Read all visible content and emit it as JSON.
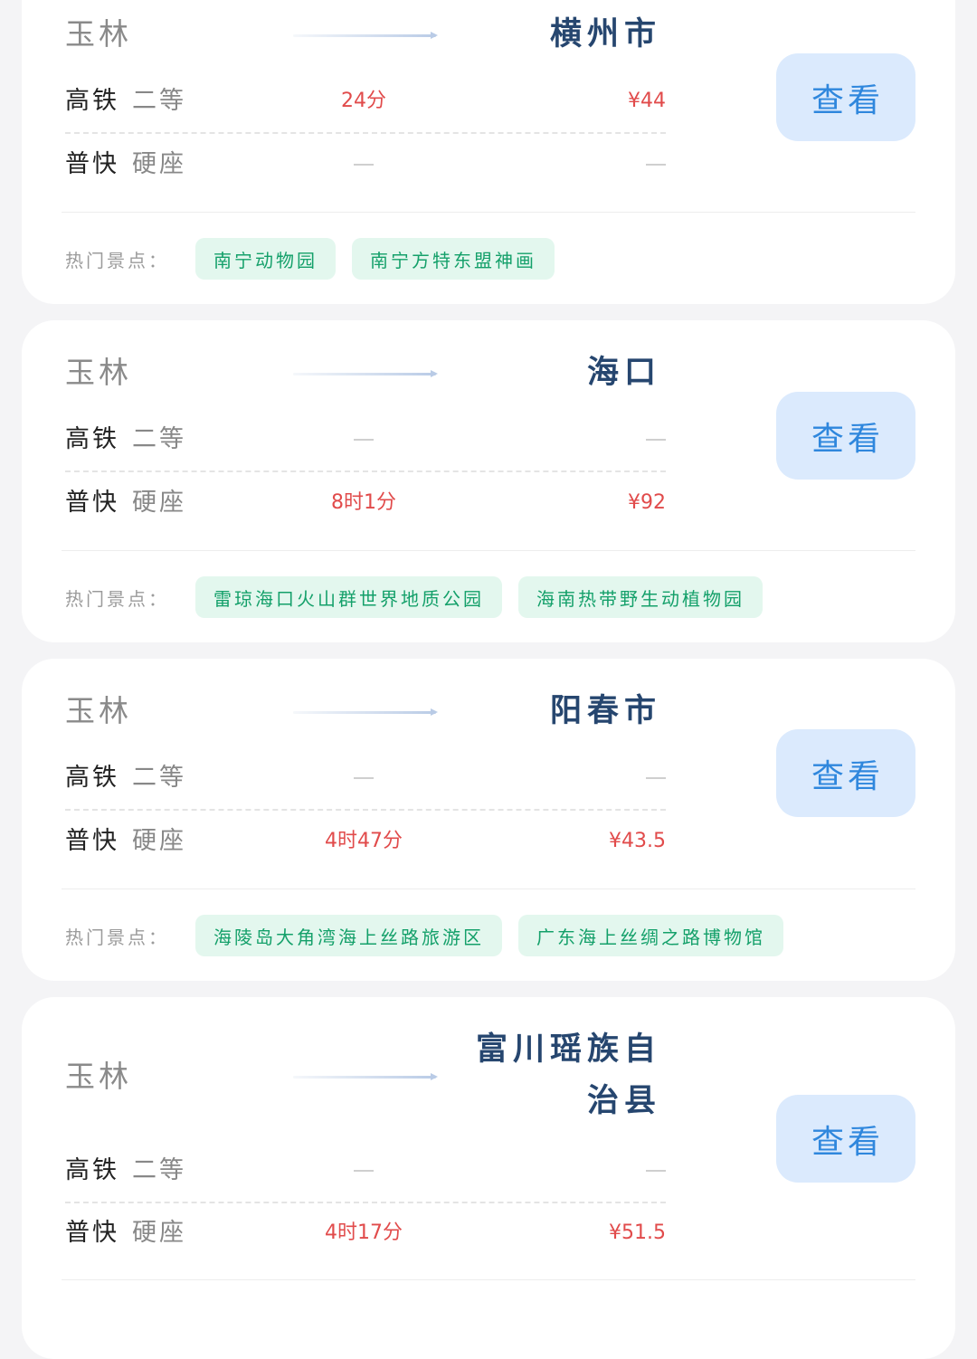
{
  "attractions_label": "热门景点：",
  "view_button_label": "查看",
  "dash_glyph": "—",
  "colors": {
    "background": "#f4f4f6",
    "card": "#ffffff",
    "origin_text": "#8a8a8a",
    "destination_text": "#26466f",
    "price_red": "#e14b4b",
    "button_bg": "#dbeafd",
    "button_text": "#2f87dd",
    "tag_bg": "#e3f7ee",
    "tag_text": "#14a06a"
  },
  "routes": [
    {
      "origin": "玉林",
      "destination": "横州市",
      "options": [
        {
          "train_type": "高铁",
          "seat": "二等",
          "duration": "24分",
          "price": "¥44"
        },
        {
          "train_type": "普快",
          "seat": "硬座",
          "duration": null,
          "price": null
        }
      ],
      "attractions": [
        "南宁动物园",
        "南宁方特东盟神画"
      ]
    },
    {
      "origin": "玉林",
      "destination": "海口",
      "options": [
        {
          "train_type": "高铁",
          "seat": "二等",
          "duration": null,
          "price": null
        },
        {
          "train_type": "普快",
          "seat": "硬座",
          "duration": "8时1分",
          "price": "¥92"
        }
      ],
      "attractions": [
        "雷琼海口火山群世界地质公园",
        "海南热带野生动植物园"
      ]
    },
    {
      "origin": "玉林",
      "destination": "阳春市",
      "options": [
        {
          "train_type": "高铁",
          "seat": "二等",
          "duration": null,
          "price": null
        },
        {
          "train_type": "普快",
          "seat": "硬座",
          "duration": "4时47分",
          "price": "¥43.5"
        }
      ],
      "attractions": [
        "海陵岛大角湾海上丝路旅游区",
        "广东海上丝绸之路博物馆"
      ]
    },
    {
      "origin": "玉林",
      "destination": "富川瑶族自治县",
      "options": [
        {
          "train_type": "高铁",
          "seat": "二等",
          "duration": null,
          "price": null
        },
        {
          "train_type": "普快",
          "seat": "硬座",
          "duration": "4时17分",
          "price": "¥51.5"
        }
      ],
      "attractions": []
    }
  ]
}
